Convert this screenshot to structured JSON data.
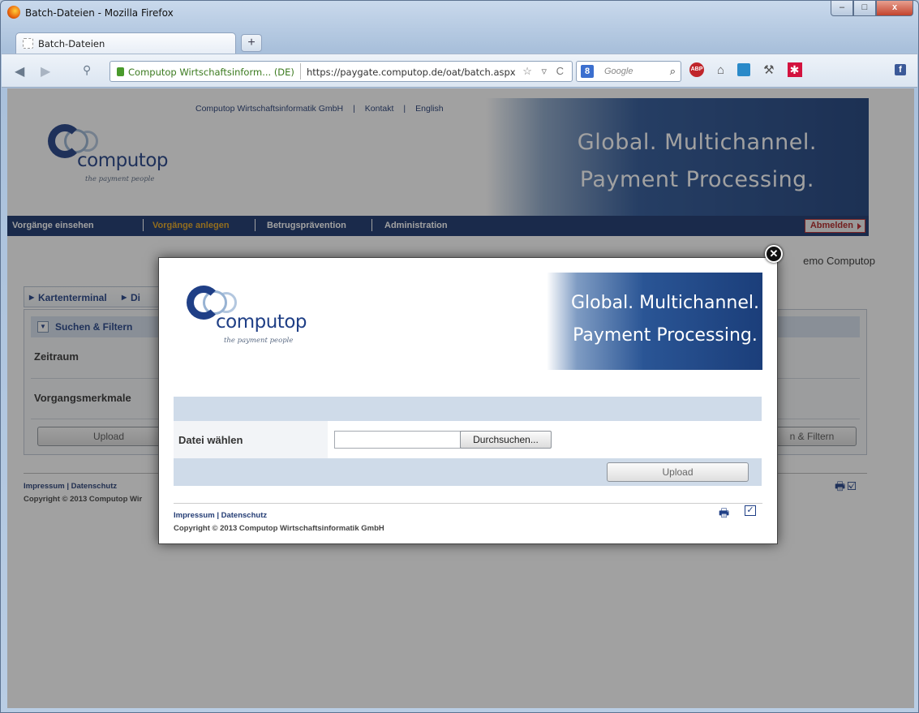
{
  "window": {
    "title": "Batch-Dateien - Mozilla Firefox",
    "controls": {
      "minimize": "–",
      "maximize": "□",
      "close": "x"
    }
  },
  "browser": {
    "tab_label": "Batch-Dateien",
    "new_tab": "+",
    "back": "◀",
    "forward": "▶",
    "identity": "Computop Wirtschaftsinform... (DE)",
    "url": "https://paygate.computop.de/oat/batch.aspx",
    "url_icons": "☆ ▿ C",
    "search_engine": "8",
    "search_placeholder": "Google",
    "search_icon": "⌕",
    "abp": "ABP",
    "home": "⌂",
    "fb": "f"
  },
  "page": {
    "top_links": [
      "Computop Wirtschaftsinformatik GmbH",
      "|",
      "Kontakt",
      "|",
      "English"
    ],
    "logo_word": "computop",
    "logo_tag": "the payment people",
    "slogan_line1": "Global. Multichannel.",
    "slogan_line2": "Payment Processing.",
    "nav": [
      "Vorgänge einsehen",
      "Vorgänge anlegen",
      "Betrugsprävention",
      "Administration"
    ],
    "logout": "Abmelden",
    "user_suffix": "emo Computop",
    "crumb_1": "Kartenterminal",
    "crumb_2": "Di",
    "panel_title": "Suchen & Filtern",
    "row_zeitraum": "Zeitraum",
    "row_vorgangsmerkmale": "Vorgangsmerkmale",
    "btn_upload": "Upload",
    "btn_filter": "n & Filtern",
    "footer_links": "Impressum | Datenschutz",
    "copyright": "Copyright © 2013 Computop Wir",
    "print_icons": "🖶☑"
  },
  "modal": {
    "logo_word": "computop",
    "logo_tag": "the payment people",
    "slogan_line1": "Global. Multichannel.",
    "slogan_line2": "Payment Processing.",
    "file_label": "Datei wählen",
    "browse_label": "Durchsuchen...",
    "upload_label": "Upload",
    "footer_links": "Impressum | Datenschutz",
    "copyright": "Copyright © 2013 Computop Wirtschaftsinformatik GmbH",
    "close_glyph": "✕",
    "print_glyph": "🖶",
    "check_glyph": "✓"
  },
  "colors": {
    "brand_navy": "#17326b",
    "nav_active": "#e6a51e",
    "logout_red": "#b02020"
  }
}
